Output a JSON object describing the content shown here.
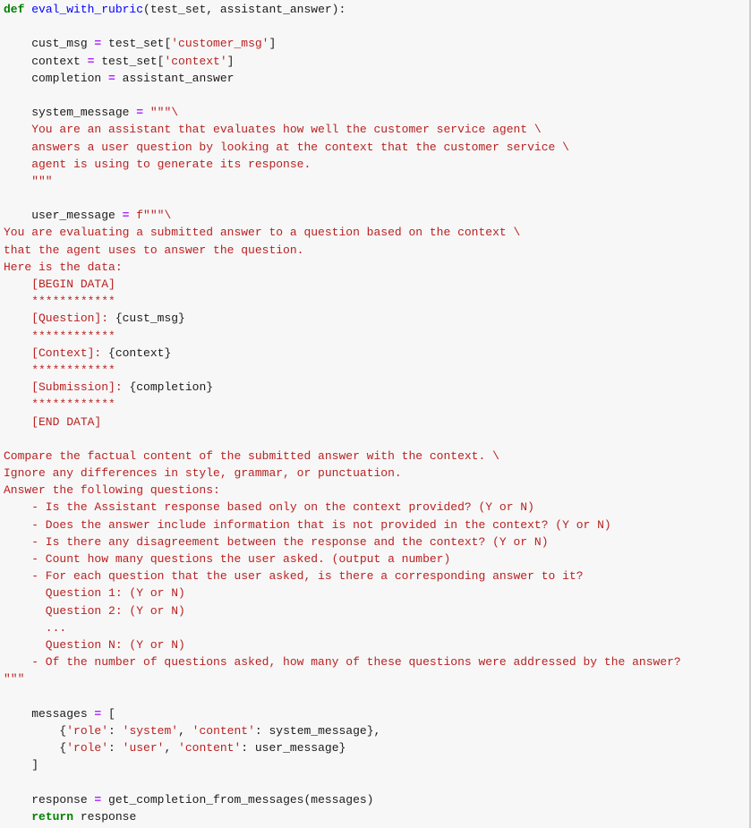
{
  "colors": {
    "background": "#f7f7f7",
    "keyword": "#008000",
    "function_name": "#0000ff",
    "operator": "#aa22ff",
    "string": "#ba2121",
    "text": "#1a1a1a"
  },
  "code": {
    "def_keyword": "def",
    "function_name": "eval_with_rubric",
    "function_params": "(test_set, assistant_answer):",
    "l_cust_msg": {
      "lhs": "    cust_msg ",
      "op": "=",
      "rhs_a": " test_set[",
      "str": "'customer_msg'",
      "rhs_b": "]"
    },
    "l_context": {
      "lhs": "    context ",
      "op": "=",
      "rhs_a": " test_set[",
      "str": "'context'",
      "rhs_b": "]"
    },
    "l_completion": {
      "lhs": "    completion ",
      "op": "=",
      "rhs": " assistant_answer"
    },
    "l_system_message": {
      "lhs": "    system_message ",
      "op": "=",
      "str": " \"\"\"\\"
    },
    "system_message_lines": [
      "    You are an assistant that evaluates how well the customer service agent \\",
      "    answers a user question by looking at the context that the customer service \\",
      "    agent is using to generate its response.",
      "    \"\"\""
    ],
    "l_user_message": {
      "lhs": "    user_message ",
      "op": "=",
      "str": " f\"\"\"\\"
    },
    "user_message_intro": [
      "You are evaluating a submitted answer to a question based on the context \\",
      "that the agent uses to answer the question.",
      "Here is the data:"
    ],
    "data_block": {
      "begin": "    [BEGIN DATA]",
      "stars": "    ************",
      "question_label": "    [Question]: ",
      "question_var": "{cust_msg}",
      "context_label": "    [Context]: ",
      "context_var": "{context}",
      "submission_label": "    [Submission]: ",
      "submission_var": "{completion}",
      "end": "    [END DATA]"
    },
    "instructions": [
      "Compare the factual content of the submitted answer with the context. \\",
      "Ignore any differences in style, grammar, or punctuation.",
      "Answer the following questions:",
      "    - Is the Assistant response based only on the context provided? (Y or N)",
      "    - Does the answer include information that is not provided in the context? (Y or N)",
      "    - Is there any disagreement between the response and the context? (Y or N)",
      "    - Count how many questions the user asked. (output a number)",
      "    - For each question that the user asked, is there a corresponding answer to it?",
      "      Question 1: (Y or N)",
      "      Question 2: (Y or N)",
      "      ...",
      "      Question N: (Y or N)",
      "    - Of the number of questions asked, how many of these questions were addressed by the answer?",
      "\"\"\""
    ],
    "l_messages": {
      "lhs": "    messages ",
      "op": "=",
      "rhs": " ["
    },
    "msg_system": {
      "a": "        {",
      "k1": "'role'",
      "b": ": ",
      "v1": "'system'",
      "c": ", ",
      "k2": "'content'",
      "d": ": system_message},"
    },
    "msg_user": {
      "a": "        {",
      "k1": "'role'",
      "b": ": ",
      "v1": "'user'",
      "c": ", ",
      "k2": "'content'",
      "d": ": user_message}"
    },
    "l_close_bracket": "    ]",
    "l_response": {
      "lhs": "    response ",
      "op": "=",
      "rhs": " get_completion_from_messages(messages)"
    },
    "l_return": {
      "indent": "    ",
      "kw": "return",
      "rhs": " response"
    }
  }
}
